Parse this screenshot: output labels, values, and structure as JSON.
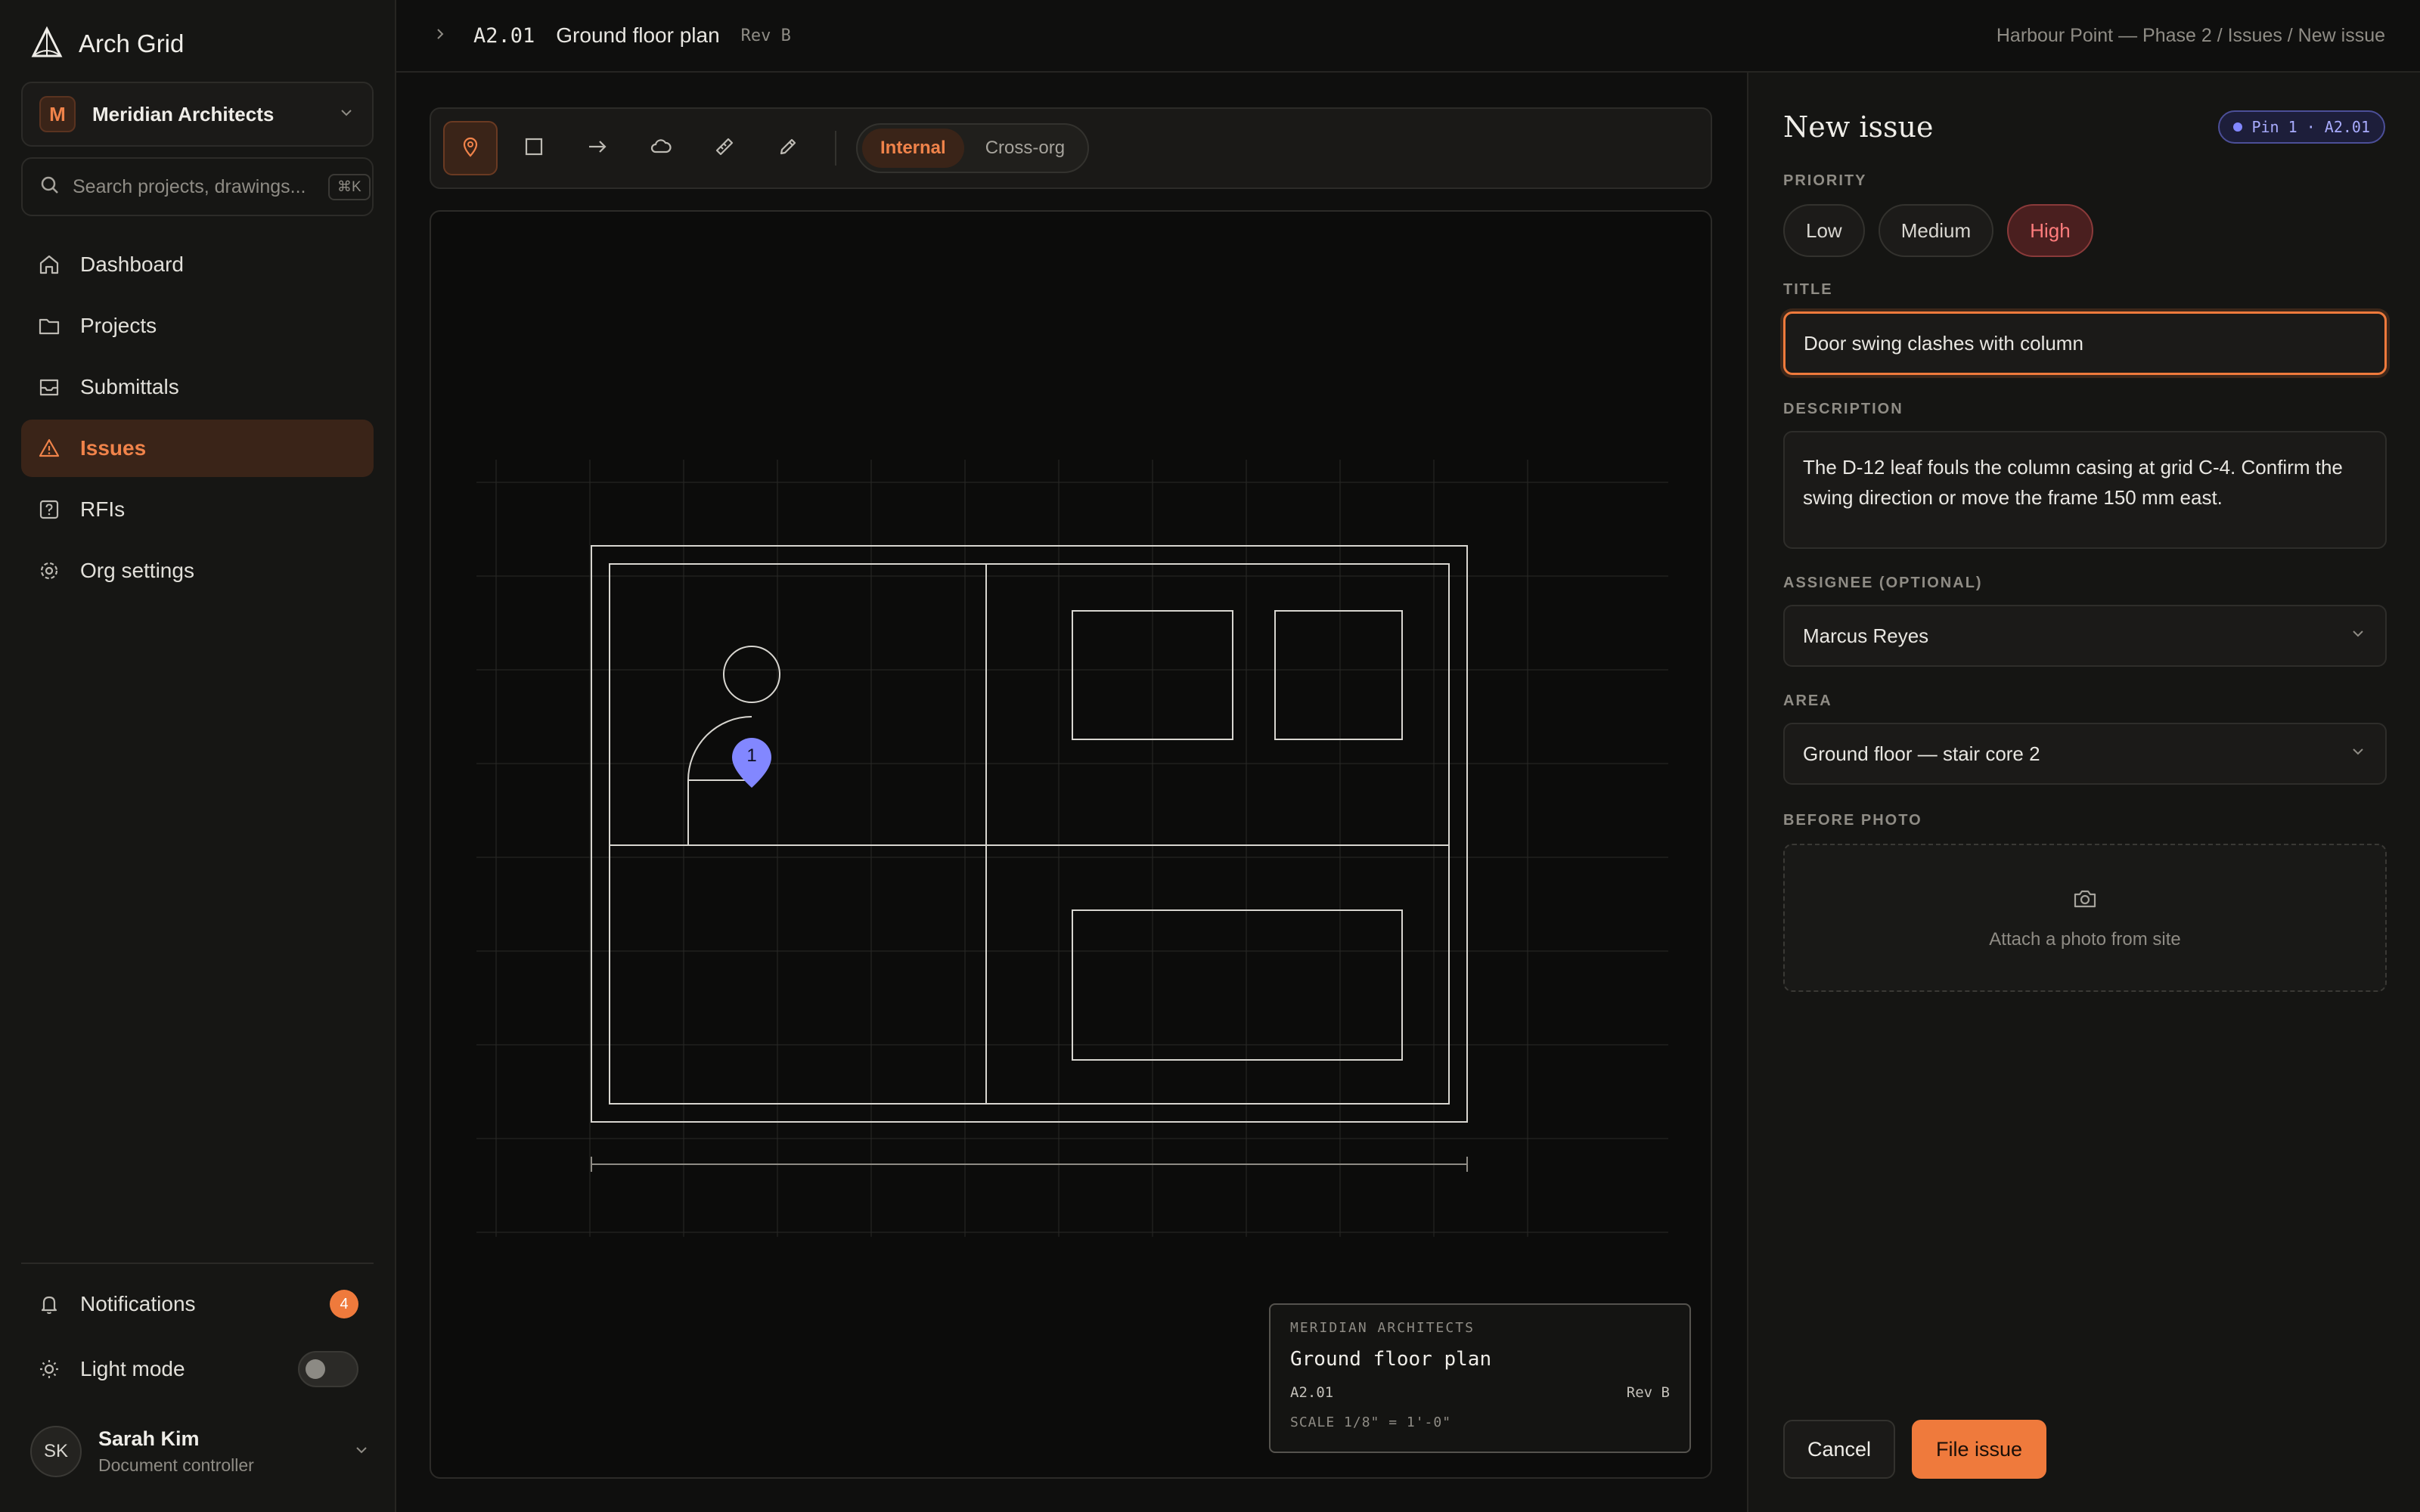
{
  "app": {
    "name": "Arch Grid"
  },
  "org": {
    "initial": "M",
    "name": "Meridian Architects"
  },
  "search": {
    "placeholder": "Search projects, drawings...",
    "shortcut": "⌘K"
  },
  "nav": {
    "items": [
      {
        "label": "Dashboard",
        "icon": "home-icon"
      },
      {
        "label": "Projects",
        "icon": "folder-icon"
      },
      {
        "label": "Submittals",
        "icon": "inbox-icon"
      },
      {
        "label": "Issues",
        "icon": "warning-icon",
        "active": true
      },
      {
        "label": "RFIs",
        "icon": "question-icon"
      },
      {
        "label": "Org settings",
        "icon": "gear-icon"
      }
    ]
  },
  "bottom": {
    "notifications_label": "Notifications",
    "notifications_count": "4",
    "light_mode_label": "Light mode"
  },
  "user": {
    "initials": "SK",
    "name": "Sarah Kim",
    "role": "Document controller"
  },
  "header": {
    "sheet_code": "A2.01",
    "sheet_title": "Ground floor plan",
    "revision": "Rev B",
    "breadcrumb": "Harbour Point — Phase 2 / Issues / New issue"
  },
  "toolbar": {
    "tools": [
      "pin-icon",
      "rectangle-icon",
      "arrow-icon",
      "cloud-icon",
      "measure-icon",
      "pencil-icon"
    ],
    "visibility": [
      "Internal",
      "Cross-org"
    ],
    "visibility_selected": "Internal"
  },
  "drawing": {
    "pin_number": "1",
    "title_block": {
      "org": "MERIDIAN ARCHITECTS",
      "title": "Ground floor plan",
      "code": "A2.01",
      "revision": "Rev B",
      "scale": "SCALE 1/8\" = 1'-0\""
    }
  },
  "panel": {
    "title": "New issue",
    "pin_badge": "Pin 1 · A2.01",
    "priority_label": "PRIORITY",
    "priorities": [
      "Low",
      "Medium",
      "High"
    ],
    "priority_selected": "High",
    "title_label": "TITLE",
    "title_value": "Door swing clashes with column",
    "description_label": "DESCRIPTION",
    "description_value": "The D-12 leaf fouls the column casing at grid C-4. Confirm the swing direction or move the frame 150 mm east.",
    "assignee_label": "ASSIGNEE (OPTIONAL)",
    "assignee_value": "Marcus Reyes",
    "area_label": "AREA",
    "area_value": "Ground floor — stair core 2",
    "photo_label": "BEFORE PHOTO",
    "photo_hint": "Attach a photo from site",
    "cancel_label": "Cancel",
    "submit_label": "File issue"
  },
  "colors": {
    "accent": "#ef7a3c",
    "priority_high": "#ff7c7c",
    "pin": "#8287ff",
    "background": "#0f0f0e"
  }
}
